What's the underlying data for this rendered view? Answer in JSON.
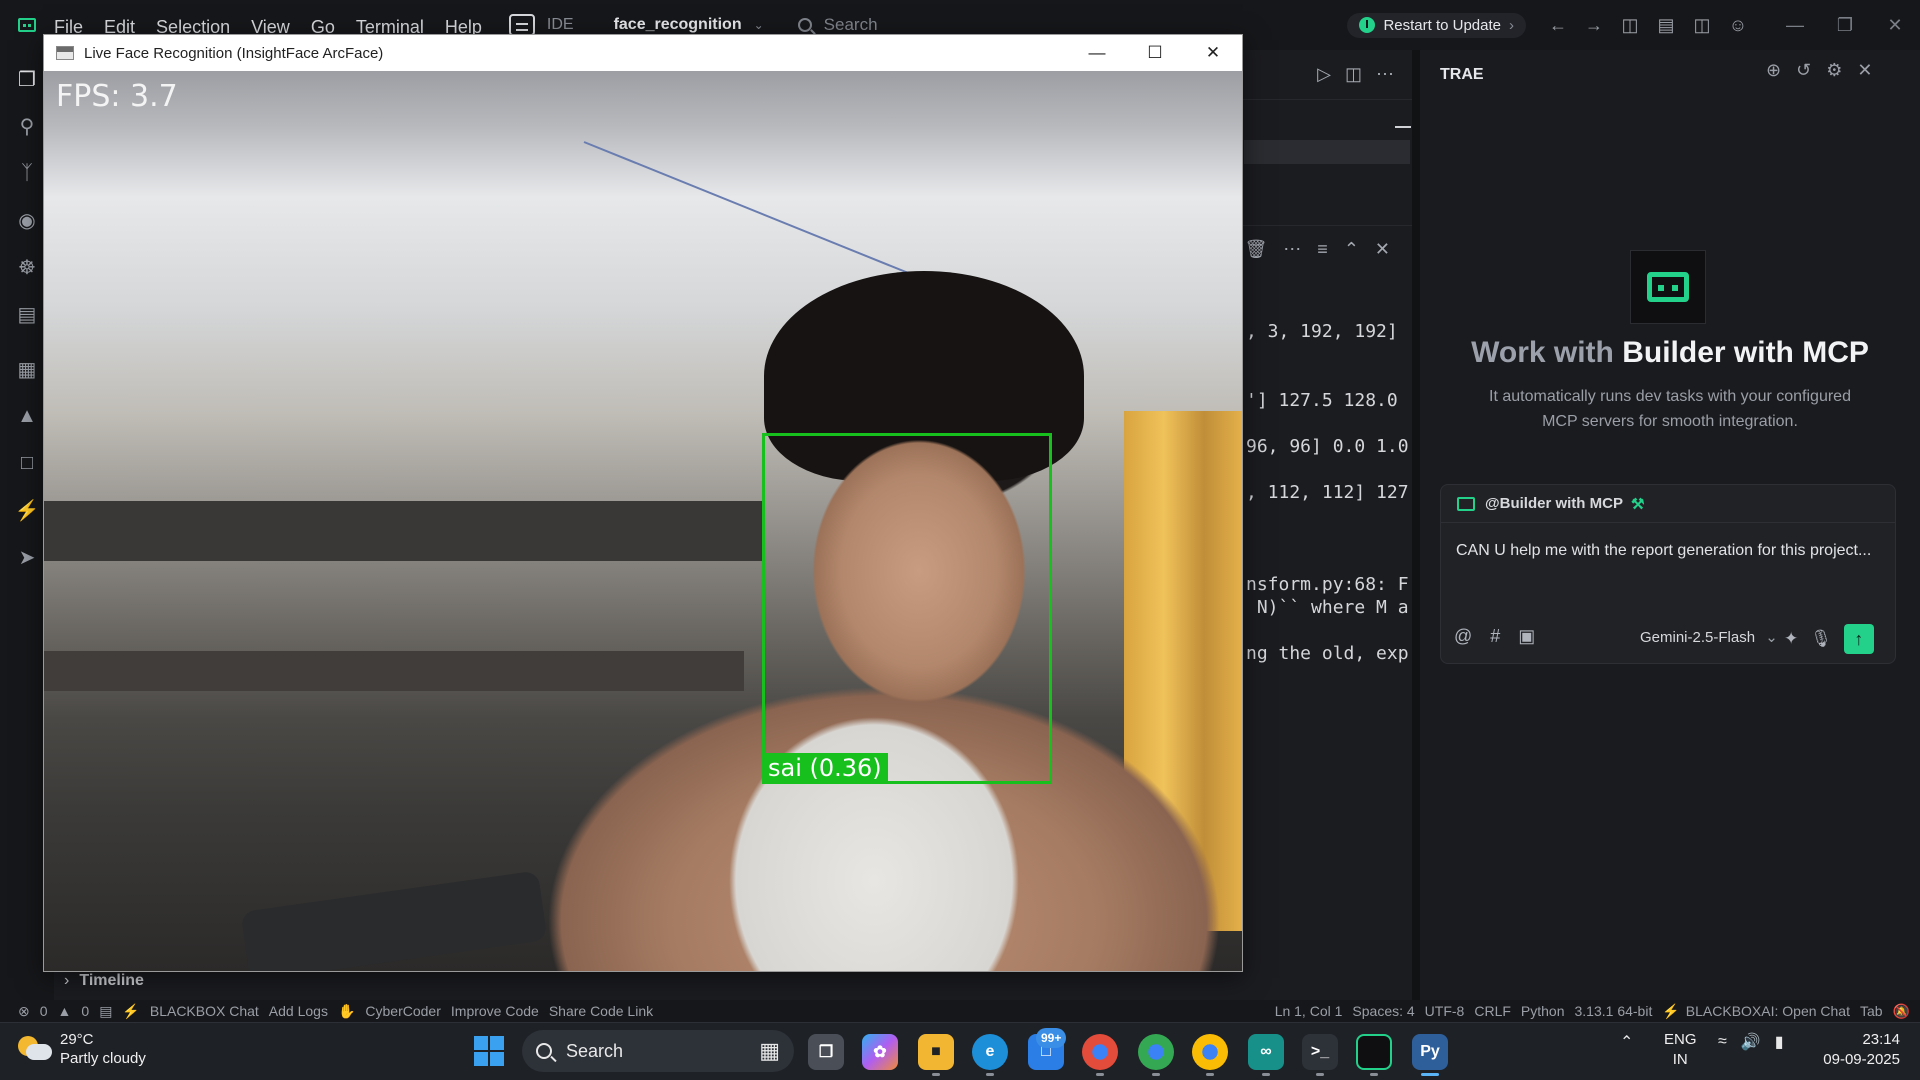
{
  "menubar": {
    "menus": [
      "File",
      "Edit",
      "Selection",
      "View",
      "Go",
      "Terminal",
      "Help"
    ],
    "ide_label": "IDE",
    "project": "face_recognition",
    "search_placeholder": "Search",
    "restart_label": "Restart to Update"
  },
  "popup": {
    "title": "Live Face Recognition (InsightFace ArcFace)",
    "fps_text": "FPS: 3.7",
    "detection_label": "sai (0.36)",
    "box_color": "#17c01d"
  },
  "terminal": {
    "lines": [
      ", 3, 192, 192]",
      "'] 127.5 128.0",
      "96, 96] 0.0 1.0",
      ", 112, 112] 127",
      "nsform.py:68: F",
      " N)`` where M a",
      "ng the old, exp"
    ]
  },
  "timeline_label": "Timeline",
  "chat": {
    "header": "TRAE",
    "hero_prefix": "Work with",
    "hero_name": "Builder with MCP",
    "description": "It automatically runs dev tasks with your configured MCP servers for smooth integration.",
    "agent": "@Builder with MCP",
    "message": "CAN U help me with the report generation for this project...",
    "model": "Gemini-2.5-Flash",
    "accent": "#23d18b"
  },
  "statusbar": {
    "errors": "0",
    "warnings": "0",
    "left_items": [
      "BLACKBOX Chat",
      "Add Logs",
      "CyberCoder",
      "Improve Code",
      "Share Code Link"
    ],
    "position": "Ln 1, Col 1",
    "spaces": "Spaces: 4",
    "encoding": "UTF-8",
    "eol": "CRLF",
    "language": "Python",
    "interpreter": "3.13.1 64-bit",
    "blackbox": "BLACKBOXAI: Open Chat",
    "tab": "Tab"
  },
  "taskbar": {
    "temperature": "29°C",
    "condition": "Partly cloudy",
    "search_label": "Search",
    "badge": "99+",
    "lang_top": "ENG",
    "lang_bottom": "IN",
    "time": "23:14",
    "date": "09-09-2025"
  }
}
